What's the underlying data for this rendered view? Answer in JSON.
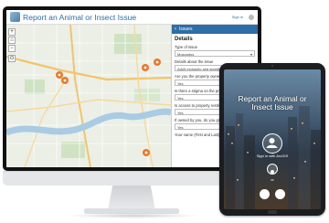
{
  "app": {
    "title": "Report an Animal or Insect Issue",
    "sign_in": "Sign in"
  },
  "map_controls": [
    "+",
    "⌂",
    "−",
    "⊙"
  ],
  "panel": {
    "header": "Issues",
    "section": "Details",
    "fields": [
      {
        "label": "Type of Issue",
        "value": "Mosquitos",
        "dropdown": true
      },
      {
        "label": "Details about the issue",
        "value": "Adult mosquito and standing water",
        "dropdown": false
      },
      {
        "label": "Are you the property owner?",
        "value": "Yes",
        "dropdown": false
      },
      {
        "label": "Is there a stigma on the property?",
        "value": "Yes",
        "dropdown": false
      },
      {
        "label": "Is access to property restricted?",
        "value": "Yes",
        "dropdown": false
      },
      {
        "label": "If owned by you, do you grant?",
        "value": "Yes",
        "dropdown": false
      },
      {
        "label": "Your name (First and Last)",
        "value": "",
        "dropdown": false
      }
    ]
  },
  "tablet": {
    "title_line1": "Report an Animal or",
    "title_line2": "Insect Issue",
    "sign_in_label": "Sign in with ArcGIS",
    "or_label": "or",
    "accent": "#2e6ea6"
  },
  "colors": {
    "brand_blue": "#2b6ea8",
    "panel_header": "#2e6ea6",
    "marker_orange": "#e8792b"
  }
}
